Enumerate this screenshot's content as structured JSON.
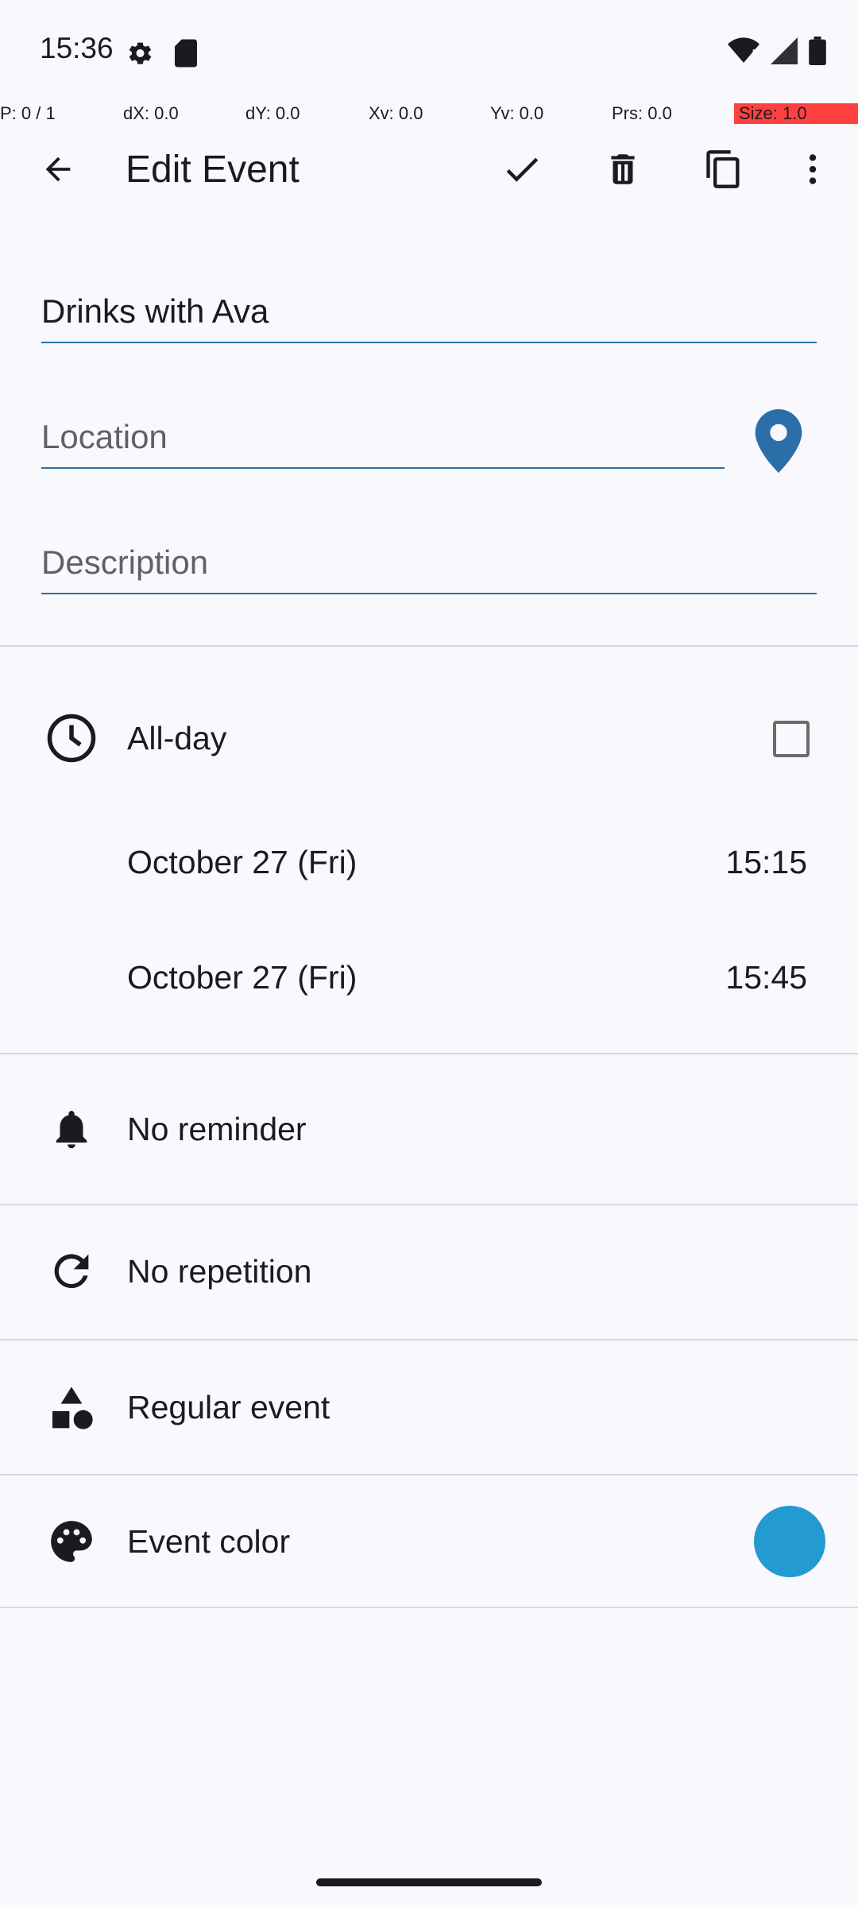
{
  "status_bar": {
    "time": "15:36"
  },
  "debug": {
    "p": "P: 0 / 1",
    "dx": "dX: 0.0",
    "dy": "dY: 0.0",
    "xv": "Xv: 0.0",
    "yv": "Yv: 0.0",
    "prs": "Prs: 0.0",
    "size": "Size: 1.0"
  },
  "toolbar": {
    "title": "Edit Event",
    "icons": [
      "back-arrow-icon",
      "check-icon",
      "delete-icon",
      "duplicate-icon",
      "more-vert-icon"
    ]
  },
  "form": {
    "title_value": "Drinks with Ava",
    "location_placeholder": "Location",
    "description_placeholder": "Description"
  },
  "all_day": {
    "label": "All-day",
    "checked": false
  },
  "start": {
    "date": "October 27 (Fri)",
    "time": "15:15"
  },
  "end": {
    "date": "October 27 (Fri)",
    "time": "15:45"
  },
  "reminder": {
    "label": "No reminder"
  },
  "repetition": {
    "label": "No repetition"
  },
  "event_type": {
    "label": "Regular event"
  },
  "event_color": {
    "label": "Event color",
    "color": "#239ad2"
  },
  "colors": {
    "accent": "#2a6fa8",
    "icon": "#1b1b1f"
  }
}
